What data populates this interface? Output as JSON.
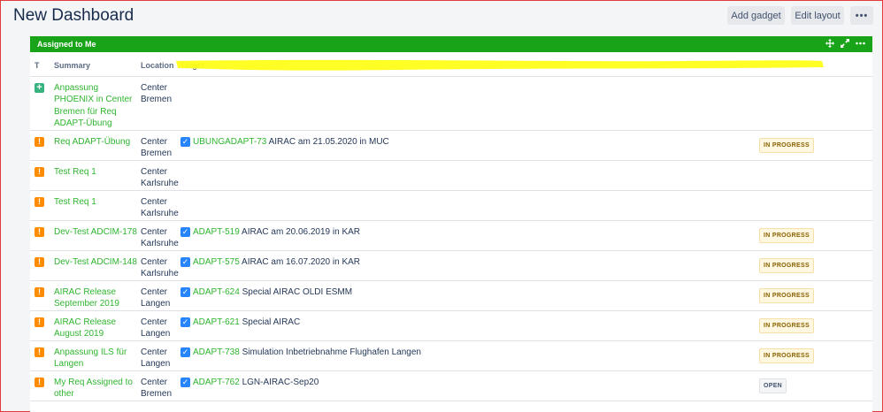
{
  "page": {
    "title": "New Dashboard",
    "buttons": {
      "add_gadget": "Add gadget",
      "edit_layout": "Edit layout",
      "more": "•••"
    }
  },
  "gadget": {
    "title": "Assigned to Me",
    "icons": [
      "move-icon",
      "expand-icon",
      "more-icon"
    ],
    "header_color": "#19a319",
    "columns": {
      "type": "T",
      "summary": "Summary",
      "location": "Location",
      "target": "Target"
    }
  },
  "rows": [
    {
      "type_icon": "new-feature-icon",
      "summary": "Anpassung PHOENIX in Center Bremen für Req ADAPT-Übung",
      "location": "Center Bremen",
      "target_key": "",
      "target_summary": "",
      "status": ""
    },
    {
      "type_icon": "requirement-icon",
      "summary": "Req ADAPT-Übung",
      "location": "Center Bremen",
      "target_key": "UBUNGADAPT-73",
      "target_summary": "AIRAC am 21.05.2020 in MUC",
      "status": "IN PROGRESS"
    },
    {
      "type_icon": "requirement-icon",
      "summary": "Test Req 1",
      "location": "Center Karlsruhe",
      "target_key": "",
      "target_summary": "",
      "status": ""
    },
    {
      "type_icon": "requirement-icon",
      "summary": "Test Req 1",
      "location": "Center Karlsruhe",
      "target_key": "",
      "target_summary": "",
      "status": ""
    },
    {
      "type_icon": "requirement-icon",
      "summary": "Dev-Test ADCIM-178",
      "location": "Center Karlsruhe",
      "target_key": "ADAPT-519",
      "target_summary": "AIRAC am 20.06.2019 in KAR",
      "status": "IN PROGRESS"
    },
    {
      "type_icon": "requirement-icon",
      "summary": "Dev-Test ADCIM-148",
      "location": "Center Karlsruhe",
      "target_key": "ADAPT-575",
      "target_summary": "AIRAC am 16.07.2020 in KAR",
      "status": "IN PROGRESS"
    },
    {
      "type_icon": "requirement-icon",
      "summary": "AIRAC Release September 2019",
      "location": "Center Langen",
      "target_key": "ADAPT-624",
      "target_summary": "Special AIRAC OLDI ESMM",
      "status": "IN PROGRESS"
    },
    {
      "type_icon": "requirement-icon",
      "summary": "AIRAC Release August 2019",
      "location": "Center Langen",
      "target_key": "ADAPT-621",
      "target_summary": "Special AIRAC",
      "status": "IN PROGRESS"
    },
    {
      "type_icon": "requirement-icon",
      "summary": "Anpassung ILS für Langen",
      "location": "Center Langen",
      "target_key": "ADAPT-738",
      "target_summary": "Simulation Inbetriebnahme Flughafen Langen",
      "status": "IN PROGRESS"
    },
    {
      "type_icon": "requirement-icon",
      "summary": "My Req Assigned to other",
      "location": "Center Bremen",
      "target_key": "ADAPT-762",
      "target_summary": "LGN-AIRAC-Sep20",
      "status": "OPEN"
    }
  ]
}
